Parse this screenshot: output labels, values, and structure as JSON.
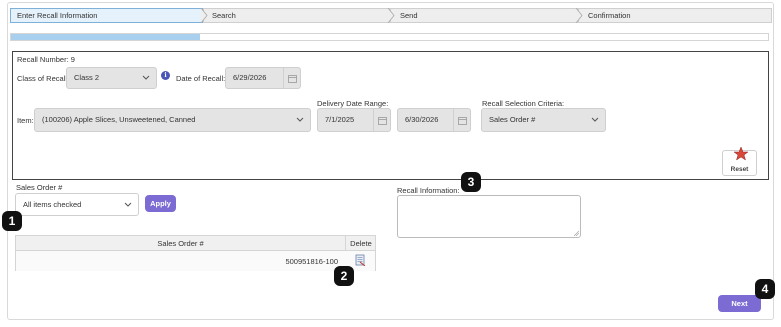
{
  "wizard": {
    "steps": [
      {
        "label": "Enter Recall Information"
      },
      {
        "label": "Search"
      },
      {
        "label": "Send"
      },
      {
        "label": "Confirmation"
      }
    ],
    "progress_fraction": 0.25
  },
  "recall_form": {
    "recall_number_label": "Recall Number: 9",
    "class_label": "Class of Recall:",
    "class_value": "Class 2",
    "info_glyph": "i",
    "date_label": "Date of Recall:",
    "date_value": "6/29/2026",
    "item_label": "Item:",
    "item_value": "(100206) Apple Slices, Unsweetened, Canned",
    "delivery_range_label": "Delivery Date Range:",
    "delivery_start": "7/1/2025",
    "delivery_end": "6/30/2026",
    "selection_criteria_label": "Recall Selection Criteria:",
    "selection_criteria_value": "Sales Order #",
    "reset_label": "Reset"
  },
  "sales_order_filter": {
    "label": "Sales Order #",
    "value": "All items checked",
    "apply_label": "Apply"
  },
  "sales_order_grid": {
    "columns": [
      "Sales Order #",
      "Delete"
    ],
    "rows": [
      {
        "sales_order": "500951816-100"
      }
    ]
  },
  "recall_information": {
    "label": "Recall Information:",
    "value": ""
  },
  "footer": {
    "next_label": "Next"
  },
  "callouts": [
    "1",
    "2",
    "3",
    "4"
  ],
  "colors": {
    "accent_button": "#7b6bd2",
    "progress_fill": "#a9cfee",
    "info_icon": "#4a56b8",
    "reset_star": "#d9463a"
  },
  "icons": {
    "dropdown": "chevron-down-icon",
    "calendar": "calendar-icon",
    "info": "info-icon",
    "reset": "reset-star-icon",
    "delete": "delete-icon"
  }
}
